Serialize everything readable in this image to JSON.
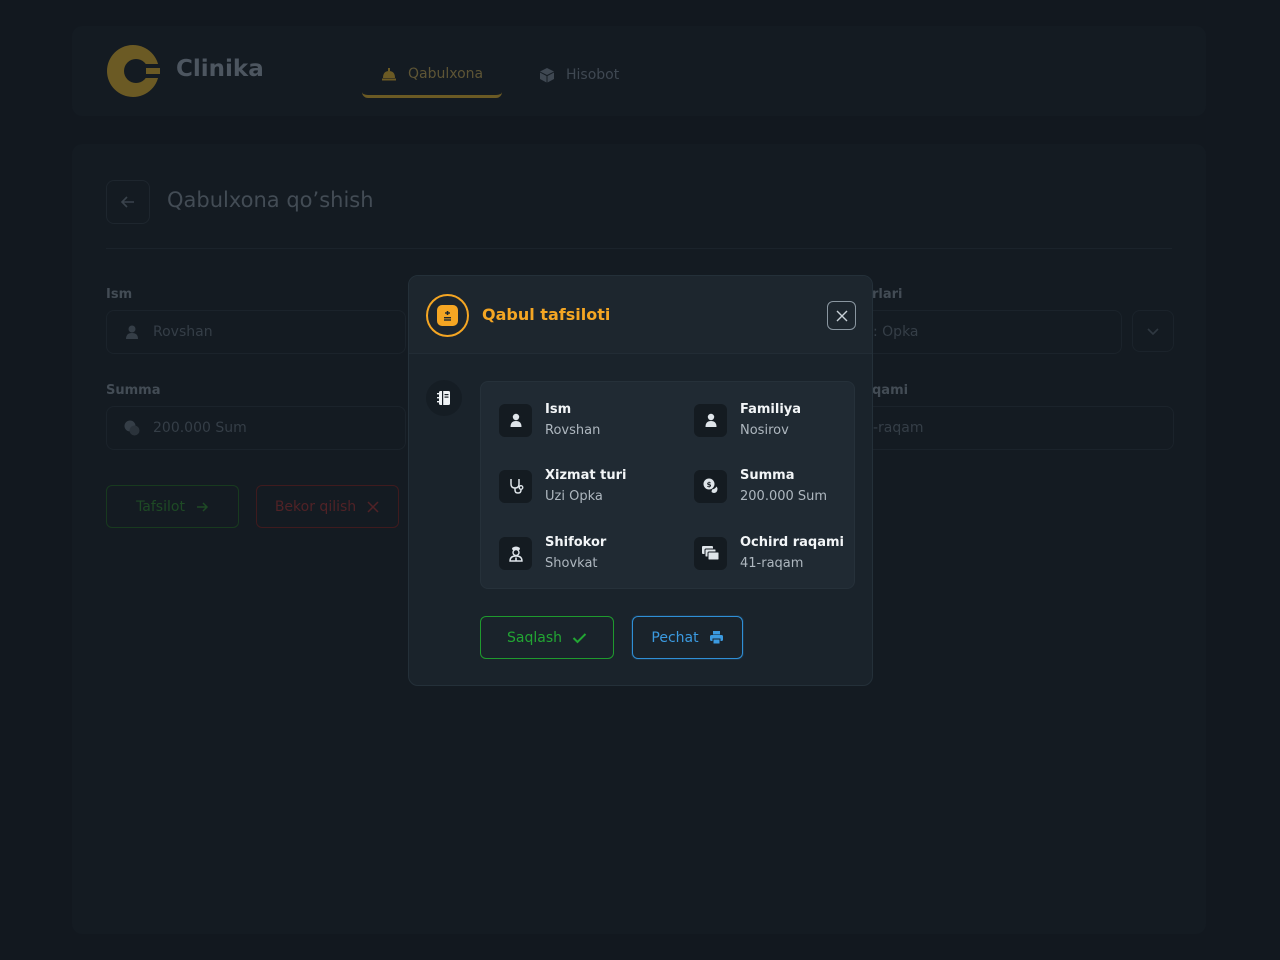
{
  "app": {
    "brand": "Clinika",
    "nav": [
      {
        "label": "Qabulxona",
        "icon": "reception-bell-icon",
        "active": true
      },
      {
        "label": "Hisobot",
        "icon": "box-icon",
        "active": false
      }
    ]
  },
  "page": {
    "title": "Qabulxona qo’shish",
    "fields": {
      "ism_label": "Ism",
      "ism_value": "Rovshan",
      "xizmat_label": "rlari",
      "xizmat_value": ": Opka",
      "summa_label": "Summa",
      "summa_value": "200.000 Sum",
      "ochird_label": "qami",
      "ochird_value": "-raqam"
    },
    "buttons": {
      "details": "Tafsilot",
      "cancel": "Bekor qilish"
    }
  },
  "modal": {
    "title": "Qabul tafsiloti",
    "details": [
      {
        "label": "Ism",
        "value": "Rovshan",
        "icon": "user-icon"
      },
      {
        "label": "Familiya",
        "value": "Nosirov",
        "icon": "user-icon"
      },
      {
        "label": "Xizmat turi",
        "value": "Uzi Opka",
        "icon": "stethoscope-icon"
      },
      {
        "label": "Summa",
        "value": "200.000 Sum",
        "icon": "coins-icon"
      },
      {
        "label": "Shifokor",
        "value": "Shovkat",
        "icon": "doctor-icon"
      },
      {
        "label": "Ochird raqami",
        "value": "41-raqam",
        "icon": "queue-cards-icon"
      }
    ],
    "buttons": {
      "save": "Saqlash",
      "print": "Pechat"
    }
  },
  "colors": {
    "accent": "#f5a623",
    "success": "#22a633",
    "info": "#3b9ae0",
    "danger": "#b43a3f",
    "background": "#12181f"
  }
}
